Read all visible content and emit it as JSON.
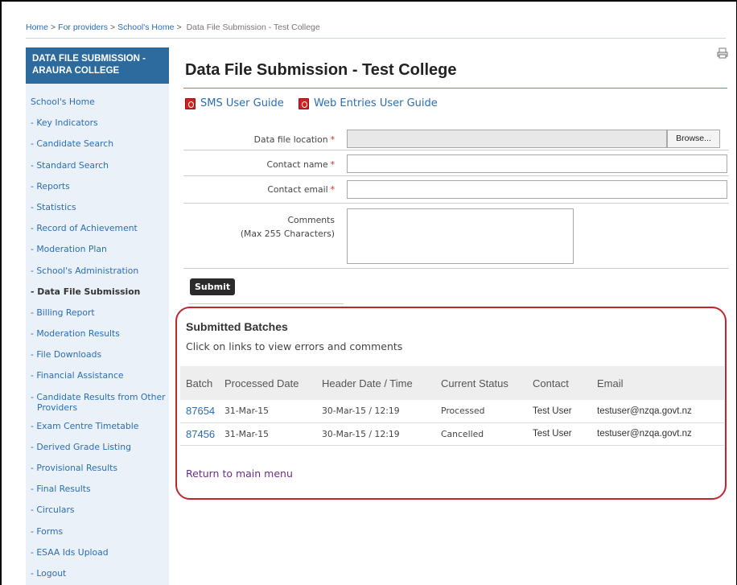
{
  "breadcrumb": {
    "items": [
      "Home",
      "For providers",
      "School's Home"
    ],
    "separator": ">",
    "current": "Data File Submission - Test College"
  },
  "sidebar": {
    "title": "DATA FILE SUBMISSION - ARAURA COLLEGE",
    "items": [
      "School's Home",
      "- Key Indicators",
      "- Candidate Search",
      "- Standard Search",
      "- Reports",
      "- Statistics",
      "- Record of Achievement",
      "- Moderation Plan",
      "- School's Administration",
      "- Data File Submission",
      "- Billing Report",
      "- Moderation Results",
      "- File Downloads",
      "- Financial Assistance",
      "- Candidate Results from Other",
      "Providers",
      "- Exam Centre Timetable",
      "- Derived Grade Listing",
      "- Provisional Results",
      "- Final Results",
      "- Circulars",
      "- Forms",
      "- ESAA Ids Upload",
      "- Logout"
    ],
    "active_index": 9
  },
  "page": {
    "title": "Data File Submission - Test College",
    "print_icon": "print-icon"
  },
  "guides": {
    "sms": "SMS User Guide",
    "web": "Web Entries User Guide",
    "icon": "pdf-icon"
  },
  "form": {
    "file_label": "Data file location",
    "browse_label": "Browse...",
    "name_label": "Contact name",
    "email_label": "Contact email",
    "comments_label": "Comments",
    "comments_hint": "(Max 255 Characters)",
    "required_mark": "*",
    "submit_label": "Submit"
  },
  "batches": {
    "title": "Submitted Batches",
    "subtitle": "Click on links to view errors and comments",
    "columns": [
      "Batch",
      "Processed Date",
      "Header Date / Time",
      "Current Status",
      "Contact",
      "Email"
    ],
    "rows": [
      {
        "batch": "87654",
        "processed": "31-Mar-15",
        "header": "30-Mar-15 / 12:19",
        "status": "Processed",
        "contact": "Test User",
        "email": "testuser@nzqa.govt.nz"
      },
      {
        "batch": "87456",
        "processed": "31-Mar-15",
        "header": "30-Mar-15 / 12:19",
        "status": "Cancelled",
        "contact": "Test User",
        "email": "testuser@nzqa.govt.nz"
      }
    ],
    "return_link": "Return to main menu",
    "highlight_color": "#c0262d"
  }
}
